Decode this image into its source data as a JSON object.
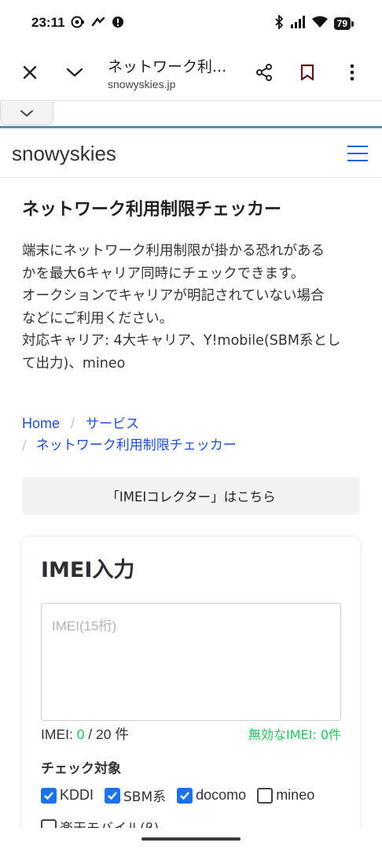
{
  "status_bar": {
    "time": "23:11",
    "left_icons": [
      "camera-app-icon",
      "link-app-icon",
      "alert-icon"
    ],
    "right_icons": [
      "bluetooth-icon",
      "signal-icon",
      "wifi-icon"
    ],
    "battery": "79"
  },
  "browser": {
    "page_title": "ネットワーク利...",
    "url": "snowyskies.jp",
    "icons": [
      "close-icon",
      "chevron-down-icon",
      "share-icon",
      "bookmark-icon",
      "more-vert-icon"
    ]
  },
  "site": {
    "name": "snowyskies"
  },
  "main": {
    "heading": "ネットワーク利用制限チェッカー",
    "description_lines": [
      "端末にネットワーク利用制限が掛かる恐れがある",
      "かを最大6キャリア同時にチェックできます。",
      "オークションでキャリアが明記されていない場合",
      "などにご利用ください。",
      "対応キャリア: 4大キャリア、Y!mobile(SBM系とし",
      "て出力)、mineo"
    ],
    "breadcrumb": {
      "home": "Home",
      "services": "サービス",
      "current": "ネットワーク利用制限チェッカー",
      "separator": "/"
    },
    "collector_button": "「IMEIコレクター」はこちら"
  },
  "imei_card": {
    "title": "IMEI入力",
    "placeholder": "IMEI(15桁)",
    "value": "",
    "count_label": "IMEI: ",
    "count_value": "0",
    "count_suffix": " / 20 件",
    "invalid_label": "無効なIMEI: 0件",
    "check_target_label": "チェック対象",
    "carriers": [
      {
        "label": "KDDI",
        "checked": true
      },
      {
        "label": "SBM系",
        "checked": true
      },
      {
        "label": "docomo",
        "checked": true
      },
      {
        "label": "mineo",
        "checked": false
      }
    ],
    "carrier_row2_label": "楽天モバイル(β)",
    "accent_color": "#1a73e8",
    "valid_color": "#22c55e"
  }
}
